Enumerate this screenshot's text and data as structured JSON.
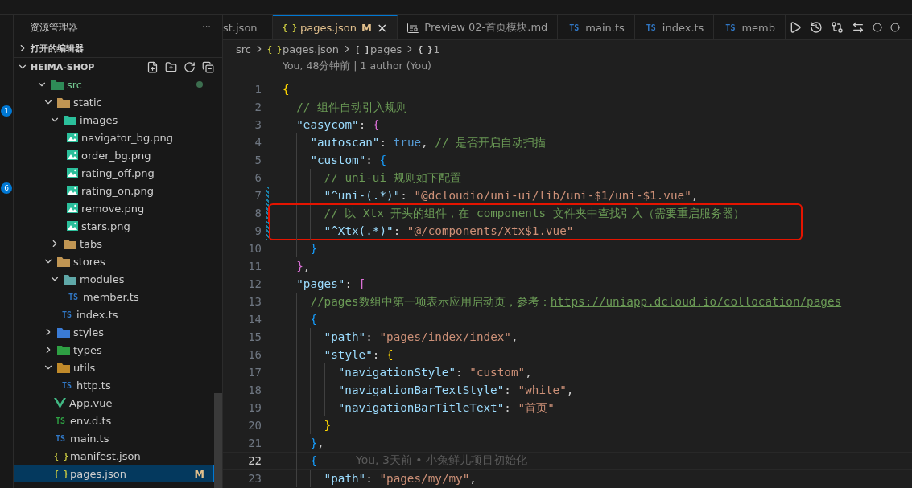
{
  "activity_bar": {
    "badges": [
      "1",
      "6"
    ]
  },
  "sidebar": {
    "title": "资源管理器",
    "more": "···",
    "open_editors": "打开的编辑器",
    "project": "HEIMA-SHOP",
    "tree": [
      {
        "name": "src",
        "kind": "folder-src",
        "expanded": true,
        "selected": false,
        "dot": true,
        "children": [
          {
            "name": "static",
            "kind": "folder",
            "expanded": true,
            "selected": false,
            "dot": false,
            "children": [
              {
                "name": "images",
                "kind": "folder-images",
                "expanded": true,
                "selected": false,
                "dot": false,
                "children": [
                  {
                    "name": "navigator_bg.png",
                    "kind": "image",
                    "selected": false,
                    "dot": false
                  },
                  {
                    "name": "order_bg.png",
                    "kind": "image",
                    "selected": false,
                    "dot": false
                  },
                  {
                    "name": "rating_off.png",
                    "kind": "image",
                    "selected": false,
                    "dot": false
                  },
                  {
                    "name": "rating_on.png",
                    "kind": "image",
                    "selected": false,
                    "dot": false
                  },
                  {
                    "name": "remove.png",
                    "kind": "image",
                    "selected": false,
                    "dot": false
                  },
                  {
                    "name": "stars.png",
                    "kind": "image",
                    "selected": false,
                    "dot": false
                  }
                ]
              },
              {
                "name": "tabs",
                "kind": "folder",
                "expanded": false,
                "selected": false,
                "dot": false
              }
            ]
          },
          {
            "name": "stores",
            "kind": "folder",
            "expanded": true,
            "selected": false,
            "dot": false,
            "children": [
              {
                "name": "modules",
                "kind": "folder-modules",
                "expanded": true,
                "selected": false,
                "dot": false,
                "children": [
                  {
                    "name": "member.ts",
                    "kind": "ts",
                    "icon_label": "TS",
                    "selected": false,
                    "dot": false
                  }
                ]
              },
              {
                "name": "index.ts",
                "kind": "ts",
                "icon_label": "TS",
                "selected": false,
                "dot": false
              }
            ]
          },
          {
            "name": "styles",
            "kind": "folder-styles",
            "expanded": false,
            "selected": false,
            "dot": false
          },
          {
            "name": "types",
            "kind": "folder-types",
            "expanded": false,
            "selected": false,
            "dot": false
          },
          {
            "name": "utils",
            "kind": "folder-utils",
            "expanded": true,
            "selected": false,
            "dot": false,
            "children": [
              {
                "name": "http.ts",
                "kind": "ts",
                "icon_label": "TS",
                "selected": false,
                "dot": false
              }
            ]
          },
          {
            "name": "App.vue",
            "kind": "vue",
            "selected": false,
            "dot": false
          },
          {
            "name": "env.d.ts",
            "kind": "dts",
            "icon_label": "TS",
            "selected": false,
            "dot": false
          },
          {
            "name": "main.ts",
            "kind": "ts",
            "icon_label": "TS",
            "selected": false,
            "dot": false
          },
          {
            "name": "manifest.json",
            "kind": "json",
            "icon_label": "{ }",
            "selected": false,
            "dot": false
          },
          {
            "name": "pages.json",
            "kind": "json",
            "icon_label": "{ }",
            "selected": true,
            "dot": false,
            "badge": "M"
          }
        ]
      }
    ]
  },
  "tabs": [
    {
      "label": "st.json",
      "kind": "plain",
      "selected": false
    },
    {
      "label": "pages.json",
      "kind": "json",
      "icon_label": "{ }",
      "selected": true,
      "badge": "M",
      "close": "×"
    },
    {
      "label": "Preview 02-首页模块.md",
      "kind": "preview",
      "selected": false
    },
    {
      "label": "main.ts",
      "kind": "ts",
      "icon_label": "TS",
      "selected": false
    },
    {
      "label": "index.ts",
      "kind": "ts",
      "icon_label": "TS",
      "selected": false
    },
    {
      "label": "memb",
      "kind": "ts",
      "icon_label": "TS",
      "selected": false
    }
  ],
  "breadcrumb": [
    {
      "text": "src"
    },
    {
      "icon_label": "{ }",
      "kind": "json",
      "text": "pages.json"
    },
    {
      "icon_label": "[ ]",
      "kind": "array",
      "text": "pages"
    },
    {
      "icon_label": "{ }",
      "kind": "object",
      "text": "1"
    }
  ],
  "codelens": "You, 48分钟前 | 1 author (You)",
  "editor": {
    "lines": [
      {
        "number": "1",
        "current": false,
        "changed": false,
        "tokens": [
          {
            "kind": "b1",
            "text": "{"
          }
        ]
      },
      {
        "number": "2",
        "current": false,
        "changed": false,
        "tokens": [
          {
            "kind": "comment",
            "text": "  // 组件自动引入规则"
          }
        ]
      },
      {
        "number": "3",
        "current": false,
        "changed": false,
        "tokens": [
          {
            "kind": "key",
            "text": "  \"easycom\""
          },
          {
            "kind": "punct",
            "text": ": "
          },
          {
            "kind": "b2",
            "text": "{"
          }
        ]
      },
      {
        "number": "4",
        "current": false,
        "changed": false,
        "tokens": [
          {
            "kind": "key",
            "text": "    \"autoscan\""
          },
          {
            "kind": "punct",
            "text": ": "
          },
          {
            "kind": "bool",
            "text": "true"
          },
          {
            "kind": "punct",
            "text": ", "
          },
          {
            "kind": "comment",
            "text": "// 是否开启自动扫描"
          }
        ]
      },
      {
        "number": "5",
        "current": false,
        "changed": false,
        "tokens": [
          {
            "kind": "key",
            "text": "    \"custom\""
          },
          {
            "kind": "punct",
            "text": ": "
          },
          {
            "kind": "b3",
            "text": "{"
          }
        ]
      },
      {
        "number": "6",
        "current": false,
        "changed": false,
        "tokens": [
          {
            "kind": "comment",
            "text": "      // uni-ui 规则如下配置"
          }
        ]
      },
      {
        "number": "7",
        "current": false,
        "changed": true,
        "tokens": [
          {
            "kind": "key",
            "text": "      \"^uni-(.*)\""
          },
          {
            "kind": "punct",
            "text": ": "
          },
          {
            "kind": "string",
            "text": "\"@dcloudio/uni-ui/lib/uni-$1/uni-$1.vue\""
          },
          {
            "kind": "punct",
            "text": ","
          }
        ]
      },
      {
        "number": "8",
        "current": false,
        "changed": true,
        "highlight": true,
        "tokens": [
          {
            "kind": "comment",
            "text": "      // 以 Xtx 开头的组件，在 components 文件夹中查找引入（需要重启服务器）"
          }
        ]
      },
      {
        "number": "9",
        "current": false,
        "changed": true,
        "highlight": true,
        "tokens": [
          {
            "kind": "key",
            "text": "      \"^Xtx(.*)\""
          },
          {
            "kind": "punct",
            "text": ": "
          },
          {
            "kind": "string",
            "text": "\"@/components/Xtx$1.vue\""
          }
        ]
      },
      {
        "number": "10",
        "current": false,
        "changed": false,
        "tokens": [
          {
            "kind": "b3",
            "text": "    }"
          }
        ]
      },
      {
        "number": "11",
        "current": false,
        "changed": false,
        "tokens": [
          {
            "kind": "b2",
            "text": "  }"
          },
          {
            "kind": "punct",
            "text": ","
          }
        ]
      },
      {
        "number": "12",
        "current": false,
        "changed": false,
        "tokens": [
          {
            "kind": "key",
            "text": "  \"pages\""
          },
          {
            "kind": "punct",
            "text": ": "
          },
          {
            "kind": "b2",
            "text": "["
          }
        ]
      },
      {
        "number": "13",
        "current": false,
        "changed": false,
        "tokens": [
          {
            "kind": "comment",
            "text": "    //pages数组中第一项表示应用启动页，参考："
          },
          {
            "kind": "link",
            "text": "https://uniapp.dcloud.io/collocation/pages"
          }
        ]
      },
      {
        "number": "14",
        "current": false,
        "changed": false,
        "tokens": [
          {
            "kind": "b3",
            "text": "    {"
          }
        ]
      },
      {
        "number": "15",
        "current": false,
        "changed": false,
        "tokens": [
          {
            "kind": "key",
            "text": "      \"path\""
          },
          {
            "kind": "punct",
            "text": ": "
          },
          {
            "kind": "string",
            "text": "\"pages/index/index\""
          },
          {
            "kind": "punct",
            "text": ","
          }
        ]
      },
      {
        "number": "16",
        "current": false,
        "changed": false,
        "tokens": [
          {
            "kind": "key",
            "text": "      \"style\""
          },
          {
            "kind": "punct",
            "text": ": "
          },
          {
            "kind": "b1",
            "text": "{"
          }
        ]
      },
      {
        "number": "17",
        "current": false,
        "changed": false,
        "tokens": [
          {
            "kind": "key",
            "text": "        \"navigationStyle\""
          },
          {
            "kind": "punct",
            "text": ": "
          },
          {
            "kind": "string",
            "text": "\"custom\""
          },
          {
            "kind": "punct",
            "text": ","
          }
        ]
      },
      {
        "number": "18",
        "current": false,
        "changed": false,
        "tokens": [
          {
            "kind": "key",
            "text": "        \"navigationBarTextStyle\""
          },
          {
            "kind": "punct",
            "text": ": "
          },
          {
            "kind": "string",
            "text": "\"white\""
          },
          {
            "kind": "punct",
            "text": ","
          }
        ]
      },
      {
        "number": "19",
        "current": false,
        "changed": false,
        "tokens": [
          {
            "kind": "key",
            "text": "        \"navigationBarTitleText\""
          },
          {
            "kind": "punct",
            "text": ": "
          },
          {
            "kind": "string",
            "text": "\"首页\""
          }
        ]
      },
      {
        "number": "20",
        "current": false,
        "changed": false,
        "tokens": [
          {
            "kind": "b1",
            "text": "      }"
          }
        ]
      },
      {
        "number": "21",
        "current": false,
        "changed": false,
        "tokens": [
          {
            "kind": "b3",
            "text": "    }"
          },
          {
            "kind": "punct",
            "text": ","
          }
        ]
      },
      {
        "number": "22",
        "current": true,
        "changed": false,
        "tokens": [
          {
            "kind": "b3",
            "text": "    {"
          },
          {
            "kind": "blame",
            "text": "You, 3天前 • 小兔鲜儿项目初始化"
          }
        ]
      },
      {
        "number": "23",
        "current": false,
        "changed": false,
        "tokens": [
          {
            "kind": "key",
            "text": "      \"path\""
          },
          {
            "kind": "punct",
            "text": ": "
          },
          {
            "kind": "string",
            "text": "\"pages/my/my\""
          },
          {
            "kind": "punct",
            "text": ","
          }
        ]
      }
    ]
  }
}
